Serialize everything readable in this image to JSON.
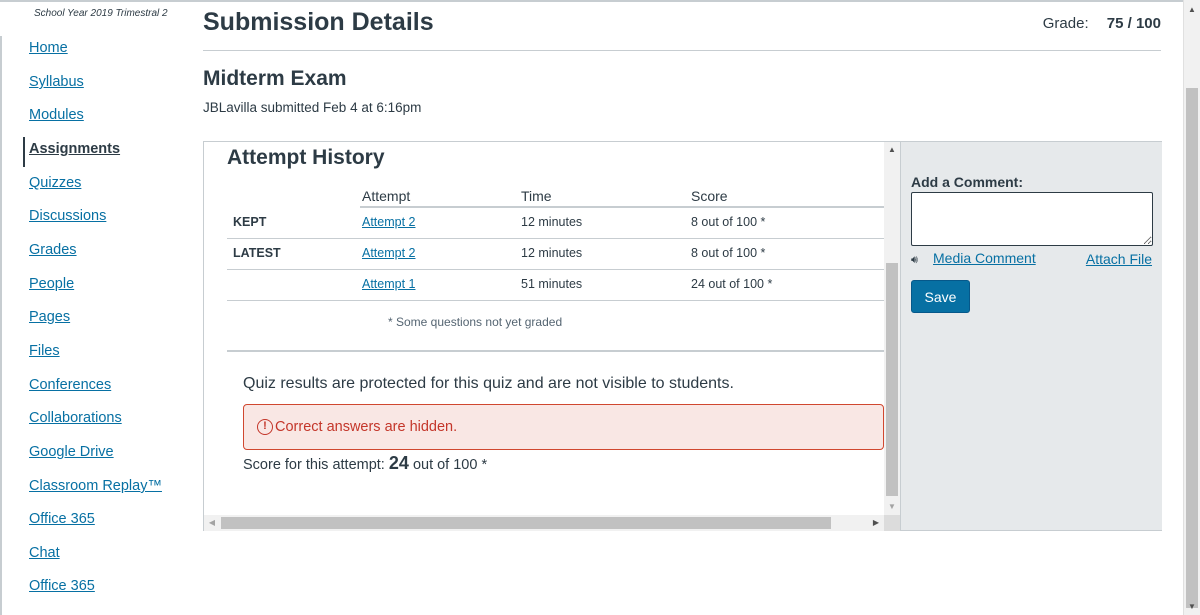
{
  "sidebar": {
    "course_subtitle": "School Year 2019 Trimestral 2",
    "items": [
      {
        "label": "Home"
      },
      {
        "label": "Syllabus"
      },
      {
        "label": "Modules"
      },
      {
        "label": "Assignments",
        "active": true
      },
      {
        "label": "Quizzes"
      },
      {
        "label": "Discussions"
      },
      {
        "label": "Grades"
      },
      {
        "label": "People"
      },
      {
        "label": "Pages"
      },
      {
        "label": "Files"
      },
      {
        "label": "Conferences"
      },
      {
        "label": "Collaborations"
      },
      {
        "label": "Google Drive"
      },
      {
        "label": "Classroom Replay™"
      },
      {
        "label": "Office 365"
      },
      {
        "label": "Chat"
      },
      {
        "label": "Office 365"
      }
    ]
  },
  "header": {
    "title": "Submission Details",
    "grade_label": "Grade:",
    "grade_value": "75 / 100"
  },
  "submission": {
    "quiz_title": "Midterm Exam",
    "submitted_by": "JBLavilla submitted Feb 4 at 6:16pm"
  },
  "attempt_history": {
    "title": "Attempt History",
    "columns": [
      "Attempt",
      "Time",
      "Score"
    ],
    "rows": [
      {
        "tag": "KEPT",
        "attempt": "Attempt 2",
        "time": "12 minutes",
        "score": "8 out of 100 *"
      },
      {
        "tag": "LATEST",
        "attempt": "Attempt 2",
        "time": "12 minutes",
        "score": "8 out of 100 *"
      },
      {
        "tag": "",
        "attempt": "Attempt 1",
        "time": "51 minutes",
        "score": "24 out of 100 *"
      }
    ],
    "footnote": "* Some questions not yet graded"
  },
  "results": {
    "protected_text": "Quiz results are protected for this quiz and are not visible to students.",
    "alert_text": "Correct answers are hidden.",
    "score_prefix": "Score for this attempt:",
    "score_value": "24",
    "score_suffix": "out of 100 *"
  },
  "comments": {
    "label": "Add a Comment:",
    "media_comment": "Media Comment",
    "attach_file": "Attach File",
    "save": "Save"
  },
  "colors": {
    "link": "#0770a3",
    "text": "#2d3b45",
    "alert_text": "#c4362a",
    "alert_bg": "#f9e7e4",
    "panel_bg": "#e6e9eb",
    "button_bg": "#0770a3"
  }
}
